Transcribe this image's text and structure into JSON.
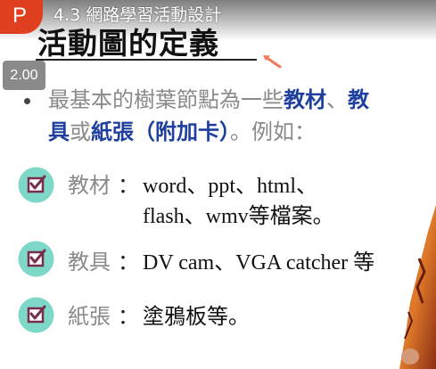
{
  "player": {
    "channel_letter": "P",
    "video_title": "4.3 網路學習活動設計",
    "playback_speed": "2.00",
    "colors": {
      "channel": "#e0401f",
      "speed_badge": "#8a8a8a"
    }
  },
  "slide": {
    "heading": "活動圖的定義",
    "bullet": {
      "line1": {
        "gray1": "最基本的樹葉節點為一些",
        "blue1": "教材",
        "gray2": "、",
        "blue2": "教"
      },
      "line2": {
        "blue1": "具",
        "gray1": "或",
        "blue2": "紙張（附加卡）",
        "gray2": "。例如："
      }
    },
    "items": [
      {
        "label": "教材",
        "colon": "：",
        "value_line1": "word、ppt、html、",
        "value_line2": "flash、wmv等檔案。"
      },
      {
        "label": "教具",
        "colon": "：",
        "value_line1": "DV cam、VGA catcher 等"
      },
      {
        "label": "紙張",
        "colon": "：",
        "value_line1": "塗鴉板等。"
      }
    ],
    "colors": {
      "highlight_blue": "#1f3f9e",
      "check_circle": "#7dd8c8",
      "check_box": "#7a2c4d",
      "arrow": "#f07a5a"
    },
    "icons": [
      "check-box-icon",
      "pointer-arrow-icon"
    ]
  }
}
